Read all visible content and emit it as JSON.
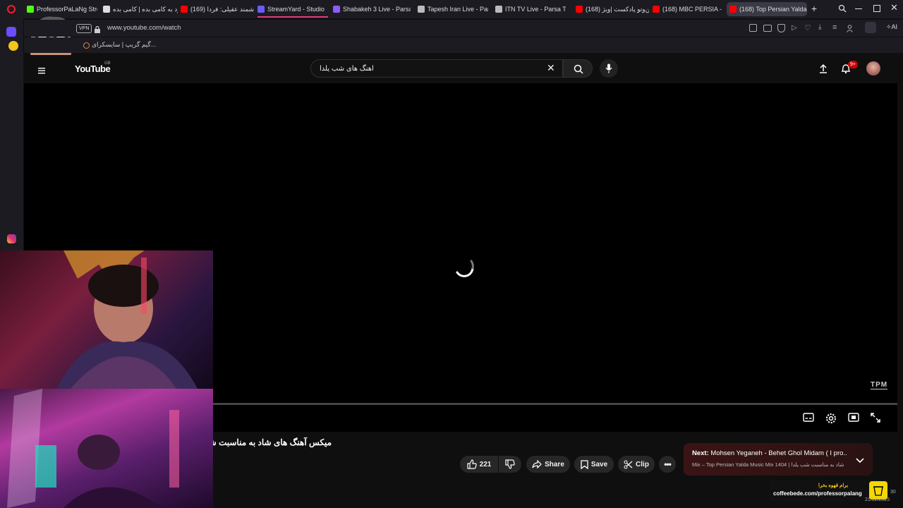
{
  "browser": {
    "tabs": [
      {
        "label": "ProfessorPaLaNg Stream",
        "color": "#53fc18"
      },
      {
        "label": "ورود به کامی بده | کامی بده",
        "color": "#cccccc"
      },
      {
        "label": "(169) هوشمند عقیلی: فردا",
        "color": "#ff0000"
      },
      {
        "label": "StreamYard - Studio",
        "color": "#6b5cff"
      },
      {
        "label": "Shabakeh 3 Live - Parsa T",
        "color": "#8b5cf6"
      },
      {
        "label": "Tapesh Iran Live - Parsa T",
        "color": "#bbbbbb"
      },
      {
        "label": "ITN TV Live - Parsa TV",
        "color": "#bbbbbb"
      },
      {
        "label": "(168) من‌وتو پادکست |ویژ",
        "color": "#ff0000"
      },
      {
        "label": "(168) MBC PERSIA - YouT",
        "color": "#ff0000"
      },
      {
        "label": "(168) Top Persian Yalda M",
        "color": "#ff0000"
      }
    ],
    "vpn_label": "VPN",
    "url": "www.youtube.com/watch",
    "ai_label": "AI",
    "bookmark_label": "گیم گریپ | سایسکرای..."
  },
  "youtube": {
    "logo_text": "YouTube",
    "logo_region": "GB",
    "search_value": "اهنگ های شب یلدا",
    "notification_badge": "9+",
    "watermark": "TPM",
    "video_title": "میکس آهنگ های شاد به مناسبت شب",
    "like_count": "221",
    "share_label": "Share",
    "save_label": "Save",
    "clip_label": "Clip",
    "next_prefix": "Next:",
    "next_title": "Mohsen Yeganeh - Behet Ghol Midam ( I pro...",
    "next_subtitle": "Mix – Top Persian Yalda Music Mix 1404 | شاد به مناسبت شب یلدا",
    "red_accent": "#ff0000"
  },
  "overlay": {
    "donate_text": "برام قهوه بخرا",
    "donate_url": "coffeebede.com/professorpalang",
    "time_partial": "30",
    "date_partial": "21/12/2025"
  }
}
